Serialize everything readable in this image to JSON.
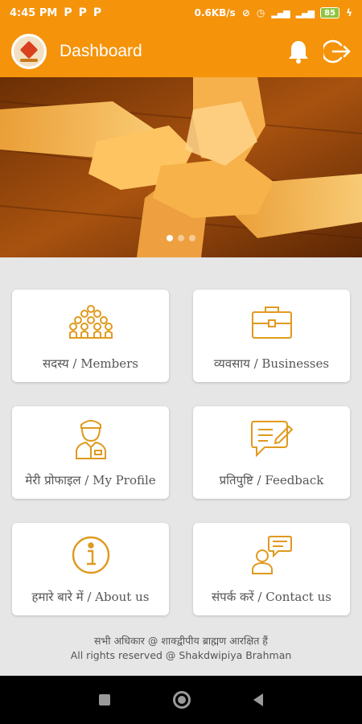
{
  "status_bar": {
    "time": "4:45 PM",
    "notif_icons": [
      "P",
      "P",
      "P"
    ],
    "net_speed": "0.6KB/s",
    "battery": "85"
  },
  "app_bar": {
    "title": "Dashboard",
    "notification_icon": "bell-icon",
    "logout_icon": "logout-icon",
    "accent_color": "#f5930a"
  },
  "banner": {
    "slides": 3,
    "active_slide": 1
  },
  "menu": [
    {
      "id": "members",
      "label": "सदस्य / Members",
      "icon": "members-icon"
    },
    {
      "id": "businesses",
      "label": "व्यवसाय / Businesses",
      "icon": "briefcase-icon"
    },
    {
      "id": "my-profile",
      "label": "मेरी प्रोफाइल / My Profile",
      "icon": "profile-icon"
    },
    {
      "id": "feedback",
      "label": "प्रतिपुष्टि / Feedback",
      "icon": "feedback-icon"
    },
    {
      "id": "about-us",
      "label": "हमारे बारे में / About us",
      "icon": "info-icon"
    },
    {
      "id": "contact-us",
      "label": "संपर्क करें / Contact us",
      "icon": "contact-icon"
    }
  ],
  "footer": {
    "line1": "सभी अधिकार @ शाक्द्वीपीय ब्राह्मण आरक्षित हैं",
    "line2": "All rights reserved @ Shakdwipiya Brahman"
  },
  "nav_bar": {
    "icons": [
      "recents-icon",
      "home-icon",
      "back-icon"
    ]
  }
}
